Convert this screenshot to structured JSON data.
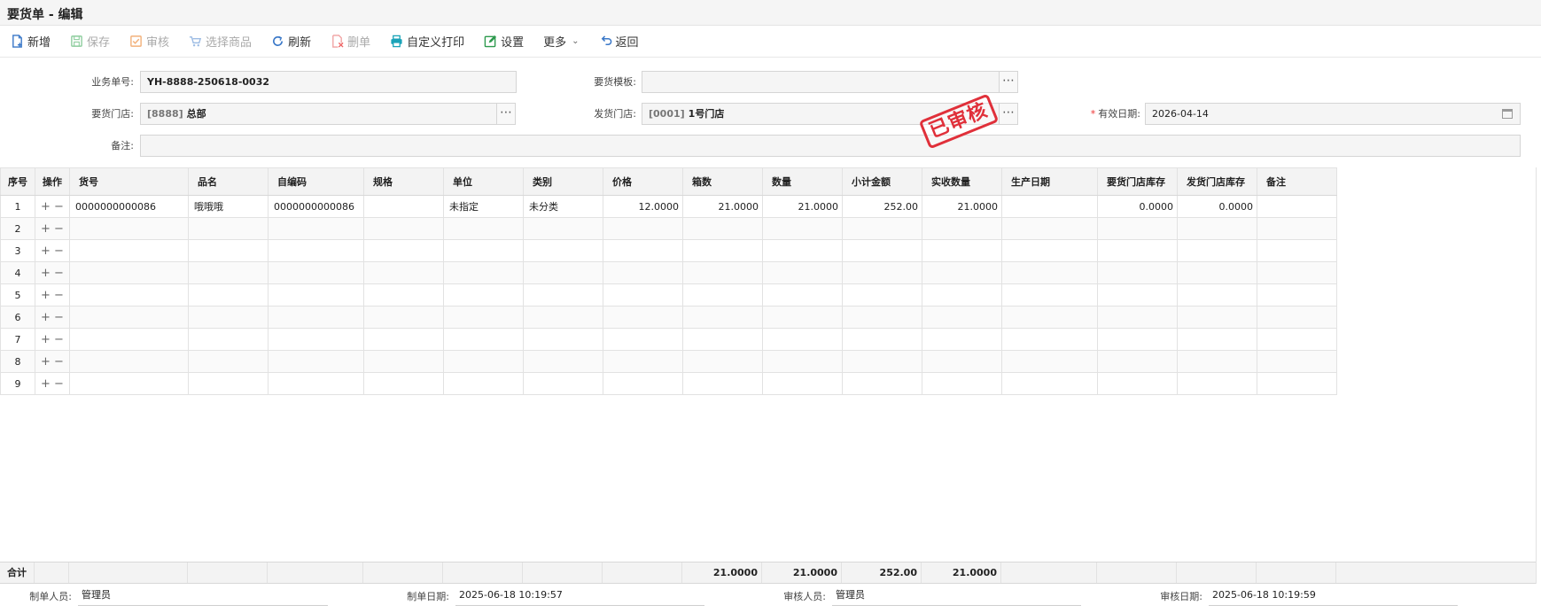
{
  "window": {
    "title": "要货单 - 编辑"
  },
  "toolbar": {
    "items": [
      {
        "label": "新增",
        "icon": "new-doc-icon",
        "disabled": false
      },
      {
        "label": "保存",
        "icon": "save-icon",
        "disabled": true
      },
      {
        "label": "审核",
        "icon": "approve-icon",
        "disabled": true
      },
      {
        "label": "选择商品",
        "icon": "cart-icon",
        "disabled": true
      },
      {
        "label": "刷新",
        "icon": "refresh-icon",
        "disabled": false
      },
      {
        "label": "删单",
        "icon": "delete-doc-icon",
        "disabled": true
      },
      {
        "label": "自定义打印",
        "icon": "printer-icon",
        "disabled": false
      },
      {
        "label": "设置",
        "icon": "settings-edit-icon",
        "disabled": false
      },
      {
        "label": "更多",
        "icon": "chevron-down-icon",
        "disabled": false
      },
      {
        "label": "返回",
        "icon": "back-arrow-icon",
        "disabled": false
      }
    ]
  },
  "form": {
    "order_no": {
      "label": "业务单号:",
      "value": "YH-8888-250618-0032"
    },
    "template": {
      "label": "要货模板:",
      "value": ""
    },
    "request_store": {
      "label": "要货门店:",
      "code": "[8888]",
      "name": "总部"
    },
    "ship_store": {
      "label": "发货门店:",
      "code": "[0001]",
      "name": "1号门店"
    },
    "valid_date": {
      "label": "有效日期:",
      "required_mark": "*",
      "value": "2026-04-14"
    },
    "remark": {
      "label": "备注:",
      "value": ""
    },
    "stamp": "已审核"
  },
  "grid": {
    "columns": [
      "序号",
      "操作",
      "货号",
      "品名",
      "自编码",
      "规格",
      "单位",
      "类别",
      "价格",
      "箱数",
      "数量",
      "小计金额",
      "实收数量",
      "生产日期",
      "要货门店库存",
      "发货门店库存",
      "备注"
    ],
    "rows": [
      [
        "1",
        "+ −",
        "0000000000086",
        "哦哦哦",
        "0000000000086",
        "",
        "未指定",
        "未分类",
        "12.0000",
        "21.0000",
        "21.0000",
        "252.00",
        "21.0000",
        "",
        "0.0000",
        "0.0000",
        ""
      ],
      [
        "2",
        "+ −",
        "",
        "",
        "",
        "",
        "",
        "",
        "",
        "",
        "",
        "",
        "",
        "",
        "",
        "",
        ""
      ],
      [
        "3",
        "+ −",
        "",
        "",
        "",
        "",
        "",
        "",
        "",
        "",
        "",
        "",
        "",
        "",
        "",
        "",
        ""
      ],
      [
        "4",
        "+ −",
        "",
        "",
        "",
        "",
        "",
        "",
        "",
        "",
        "",
        "",
        "",
        "",
        "",
        "",
        ""
      ],
      [
        "5",
        "+ −",
        "",
        "",
        "",
        "",
        "",
        "",
        "",
        "",
        "",
        "",
        "",
        "",
        "",
        "",
        ""
      ],
      [
        "6",
        "+ −",
        "",
        "",
        "",
        "",
        "",
        "",
        "",
        "",
        "",
        "",
        "",
        "",
        "",
        "",
        ""
      ],
      [
        "7",
        "+ −",
        "",
        "",
        "",
        "",
        "",
        "",
        "",
        "",
        "",
        "",
        "",
        "",
        "",
        "",
        ""
      ],
      [
        "8",
        "+ −",
        "",
        "",
        "",
        "",
        "",
        "",
        "",
        "",
        "",
        "",
        "",
        "",
        "",
        "",
        ""
      ],
      [
        "9",
        "+ −",
        "",
        "",
        "",
        "",
        "",
        "",
        "",
        "",
        "",
        "",
        "",
        "",
        "",
        "",
        ""
      ]
    ],
    "totals": {
      "label": "合计",
      "boxes": "21.0000",
      "qty": "21.0000",
      "amount": "252.00",
      "received": "21.0000"
    }
  },
  "footer": {
    "creator": {
      "label": "制单人员:",
      "value": "管理员"
    },
    "created_at": {
      "label": "制单日期:",
      "value": "2025-06-18 10:19:57"
    },
    "approver": {
      "label": "审核人员:",
      "value": "管理员"
    },
    "approved_at": {
      "label": "审核日期:",
      "value": "2025-06-18 10:19:59"
    }
  },
  "colors": {
    "stamp": "#e0303a",
    "icon_blue": "#3a78c8",
    "icon_green": "#2e9a4e",
    "icon_cyan": "#1aa3b8"
  }
}
